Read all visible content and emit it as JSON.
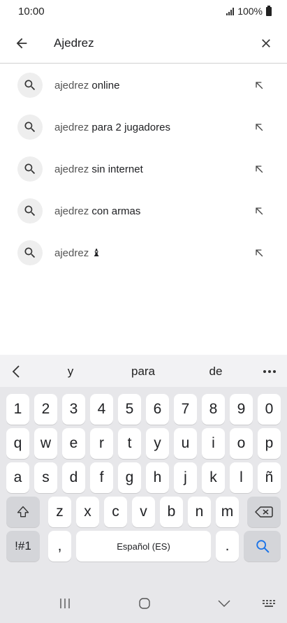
{
  "status": {
    "time": "10:00",
    "battery": "100%"
  },
  "search": {
    "query": "Ajedrez"
  },
  "suggestions": [
    {
      "prefix": "ajedrez",
      "suffix": " online"
    },
    {
      "prefix": "ajedrez",
      "suffix": " para 2 jugadores"
    },
    {
      "prefix": "ajedrez",
      "suffix": " sin internet"
    },
    {
      "prefix": "ajedrez",
      "suffix": " con armas"
    },
    {
      "prefix": "ajedrez",
      "suffix": " ♝"
    }
  ],
  "keyboard": {
    "predictions": [
      "y",
      "para",
      "de"
    ],
    "rows": [
      [
        "1",
        "2",
        "3",
        "4",
        "5",
        "6",
        "7",
        "8",
        "9",
        "0"
      ],
      [
        "q",
        "w",
        "e",
        "r",
        "t",
        "y",
        "u",
        "i",
        "o",
        "p"
      ],
      [
        "a",
        "s",
        "d",
        "f",
        "g",
        "h",
        "j",
        "k",
        "l",
        "ñ"
      ],
      [
        "z",
        "x",
        "c",
        "v",
        "b",
        "n",
        "m"
      ]
    ],
    "symbols_label": "!#1",
    "comma_label": ",",
    "space_label": "Español (ES)",
    "period_label": "."
  },
  "colors": {
    "accent": "#1a73e8",
    "keyboard_bg": "#e7e7ea",
    "key_special": "#d4d5d9"
  }
}
